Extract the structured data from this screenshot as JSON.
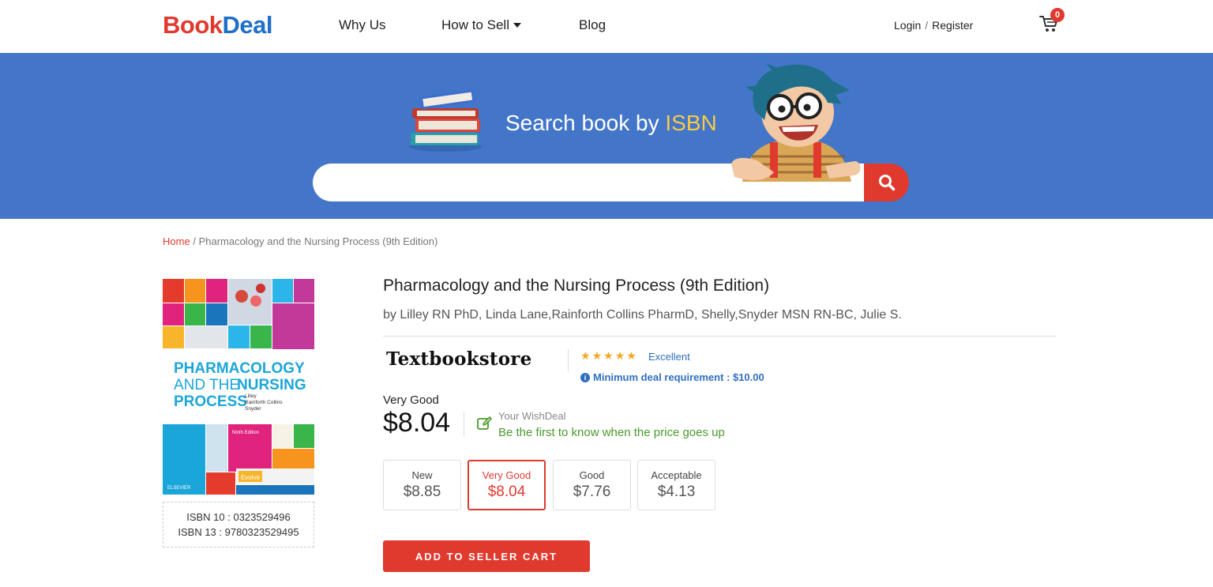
{
  "header": {
    "logo_b": "B",
    "logo_ook": "ook",
    "logo_deal": "Deal",
    "nav": {
      "why_us": "Why Us",
      "how_to_sell": "How to Sell",
      "blog": "Blog"
    },
    "login": "Login",
    "separator": "/",
    "register": "Register",
    "cart_count": "0"
  },
  "banner": {
    "title_prefix": "Search book by",
    "title_highlight": "ISBN",
    "search_value": "",
    "search_placeholder": ""
  },
  "breadcrumb": {
    "home": "Home",
    "separator": "/",
    "current": "Pharmacology and the Nursing Process (9th Edition)"
  },
  "cover": {
    "line1": "PHARMACOLOGY",
    "line2a": "AND THE",
    "line2b": "NURSING",
    "line3": "PROCESS",
    "authors1": "Lilley",
    "authors2": "Rainforth Collins",
    "authors3": "Snyder",
    "edition": "Ninth Edition",
    "evolve": "Evolve",
    "publisher": "ELSEVIER"
  },
  "isbn": {
    "isbn10": "ISBN 10 : 0323529496",
    "isbn13": "ISBN 13 : 9780323529495"
  },
  "book": {
    "title": "Pharmacology and the Nursing Process (9th Edition)",
    "authors": "by Lilley RN PhD, Linda Lane,Rainforth Collins PharmD, Shelly,Snyder MSN RN-BC, Julie S."
  },
  "seller": {
    "name": "Textbookstore",
    "stars": 5,
    "rating_text": "Excellent",
    "min_deal": "Minimum deal requirement : $10.00"
  },
  "price": {
    "condition": "Very Good",
    "amount": "$8.04"
  },
  "wishdeal": {
    "title": "Your WishDeal",
    "subtitle": "Be the first to know when the price goes up"
  },
  "conditions": [
    {
      "name": "New",
      "price": "$8.85"
    },
    {
      "name": "Very Good",
      "price": "$8.04"
    },
    {
      "name": "Good",
      "price": "$7.76"
    },
    {
      "name": "Acceptable",
      "price": "$4.13"
    }
  ],
  "add_button": "ADD TO SELLER CART",
  "colors": {
    "brand_red": "#e03a2f",
    "brand_blue": "#1e6fc8",
    "banner_blue": "#4376c8",
    "link_blue": "#2f6fc0",
    "wish_green": "#4a9a2c",
    "star_gold": "#f5a623"
  }
}
